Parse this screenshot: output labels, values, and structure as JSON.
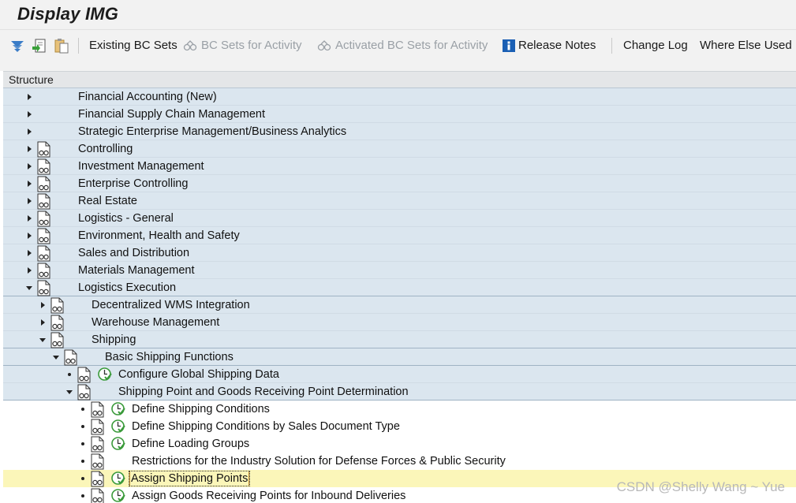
{
  "window": {
    "title": "Display IMG"
  },
  "toolbar": {
    "existing_bc_sets": "Existing BC Sets",
    "bc_sets_for_activity": "BC Sets for Activity",
    "activated_bc_sets": "Activated BC Sets for Activity",
    "release_notes": "Release Notes",
    "change_log": "Change Log",
    "where_else_used": "Where Else Used"
  },
  "structure": {
    "header": "Structure"
  },
  "tree": {
    "r0": "Financial Accounting (New)",
    "r1": "Financial Supply Chain Management",
    "r2": "Strategic Enterprise Management/Business Analytics",
    "r3": "Controlling",
    "r4": "Investment Management",
    "r5": "Enterprise Controlling",
    "r6": "Real Estate",
    "r7": "Logistics - General",
    "r8": "Environment, Health and Safety",
    "r9": "Sales and Distribution",
    "r10": "Materials Management",
    "r11": "Logistics Execution",
    "r12": "Decentralized WMS Integration",
    "r13": "Warehouse Management",
    "r14": "Shipping",
    "r15": "Basic Shipping Functions",
    "r16": "Configure Global Shipping Data",
    "r17": "Shipping Point and Goods Receiving Point Determination",
    "r18": "Define Shipping Conditions",
    "r19": "Define Shipping Conditions by Sales Document Type",
    "r20": "Define Loading Groups",
    "r21": "Restrictions for the Industry Solution for Defense Forces & Public Security",
    "r22": "Assign Shipping Points",
    "r23": "Assign Goods Receiving Points for Inbound Deliveries"
  },
  "colors": {
    "tree_blue": "#dbe6ef",
    "highlight": "#fbf6b9",
    "toolbar_bg": "#f2f2f2",
    "disabled_text": "#9aa0a6",
    "clock_green": "#3a9a3a"
  },
  "icons": [
    "filter-icon",
    "execute-icon",
    "paste-icon",
    "bc-sets-icon",
    "info-icon",
    "document-glasses-icon",
    "clock-check-icon",
    "expand-arrow-icon",
    "collapse-arrow-icon"
  ],
  "watermark": "CSDN @Shelly Wang ~ Yue"
}
